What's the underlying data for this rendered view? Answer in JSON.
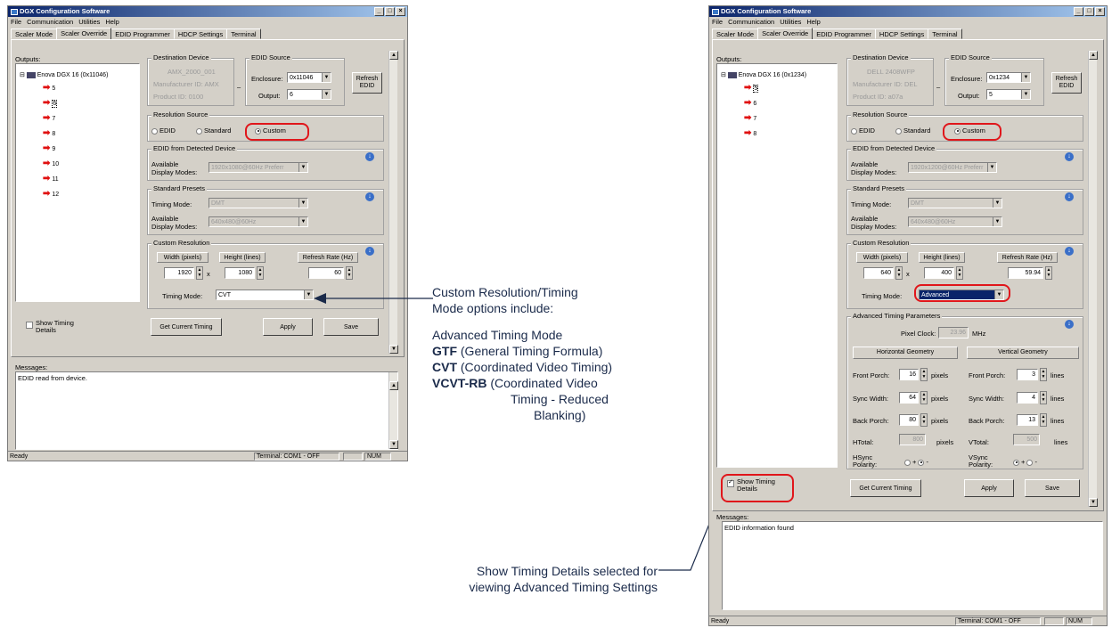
{
  "app": {
    "title": "DGX Configuration Software",
    "menu": [
      "File",
      "Communication",
      "Utilities",
      "Help"
    ],
    "tabs": [
      "Scaler Mode",
      "Scaler Override",
      "EDID Programmer",
      "HDCP Settings",
      "Terminal"
    ],
    "outputs_label": "Outputs:",
    "destination_label": "Destination Device",
    "edid_source_label": "EDID Source",
    "enclosure_label": "Enclosure:",
    "output_label": "Output:",
    "refresh_edid": "Refresh EDID",
    "resolution_source": "Resolution Source",
    "rs_edid": "EDID",
    "rs_standard": "Standard",
    "rs_custom": "Custom",
    "edid_detected": "EDID from Detected Device",
    "available_display_modes": "Available Display Modes:",
    "standard_presets": "Standard Presets",
    "timing_mode_label": "Timing Mode:",
    "custom_resolution": "Custom Resolution",
    "width_label": "Width (pixels)",
    "height_label": "Height (lines)",
    "refresh_label": "Refresh Rate (Hz)",
    "show_timing": "Show Timing Details",
    "get_current_timing": "Get Current Timing",
    "apply": "Apply",
    "save": "Save",
    "messages_label": "Messages:",
    "status_ready": "Ready",
    "status_terminal": "Terminal: COM1 - OFF",
    "status_num": "NUM"
  },
  "left": {
    "tree_root": "Enova DGX 16 (0x11046)",
    "tree_items": [
      "5",
      "6",
      "7",
      "8",
      "9",
      "10",
      "11",
      "12"
    ],
    "dest_name": "AMX_2000_001",
    "dest_mfr": "Manufacturer ID:  AMX",
    "dest_product": "Product ID:          0100",
    "enclosure": "0x11046",
    "output": "6",
    "edid_modes": "1920x1080@60Hz Preferr",
    "std_timing": "DMT",
    "std_modes": "640x480@60Hz",
    "width": "1920",
    "height": "1080",
    "refresh": "60",
    "timing_mode": "CVT",
    "message": "EDID read from device."
  },
  "right": {
    "tree_root": "Enova DGX 16 (0x1234)",
    "tree_items": [
      "5",
      "6",
      "7",
      "8"
    ],
    "dest_name": "DELL 2408WFP",
    "dest_mfr": "Manufacturer ID:  DEL",
    "dest_product": "Product ID:         a07a",
    "enclosure": "0x1234",
    "output": "5",
    "edid_modes": "1920x1200@60Hz Preferr",
    "std_timing": "DMT",
    "std_modes": "640x480@60Hz",
    "width": "640",
    "height": "400",
    "refresh": "59.94",
    "timing_mode": "Advanced",
    "adv_title": "Advanced Timing Parameters",
    "pixel_clock_label": "Pixel Clock:",
    "pixel_clock": "23.96",
    "mhz": "MHz",
    "horiz_geom": "Horizontal Geometry",
    "vert_geom": "Vertical Geometry",
    "front_porch": "Front Porch:",
    "sync_width": "Sync Width:",
    "back_porch": "Back Porch:",
    "htotal": "HTotal:",
    "vtotal": "VTotal:",
    "hsync_pol": "HSync Polarity:",
    "vsync_pol": "VSync Polarity:",
    "pixels": "pixels",
    "lines": "lines",
    "h_front": "16",
    "h_sync": "64",
    "h_back": "80",
    "h_total": "800",
    "v_front": "3",
    "v_sync": "4",
    "v_back": "13",
    "v_total": "500",
    "pol_plus": "+",
    "pol_minus": "-",
    "message": "EDID information found"
  },
  "callouts": {
    "c1_line1": "Custom Resolution/Timing",
    "c1_line2": "Mode options include:",
    "c1_item1": "Advanced Timing Mode",
    "c1_item2_b": "GTF",
    "c1_item2": " (General Timing Formula)",
    "c1_item3_b": "CVT",
    "c1_item3": " (Coordinated Video Timing)",
    "c1_item4_b": "VCVT-RB",
    "c1_item4": " (Coordinated Video",
    "c1_item4b": "Timing - Reduced",
    "c1_item4c": "Blanking)",
    "c2_line1": "Show Timing Details selected for",
    "c2_line2": "viewing Advanced Timing Settings"
  },
  "colors": {
    "highlight": "#e0161b",
    "titlebar": "#0a246a",
    "callout_text": "#1a2a4a"
  }
}
